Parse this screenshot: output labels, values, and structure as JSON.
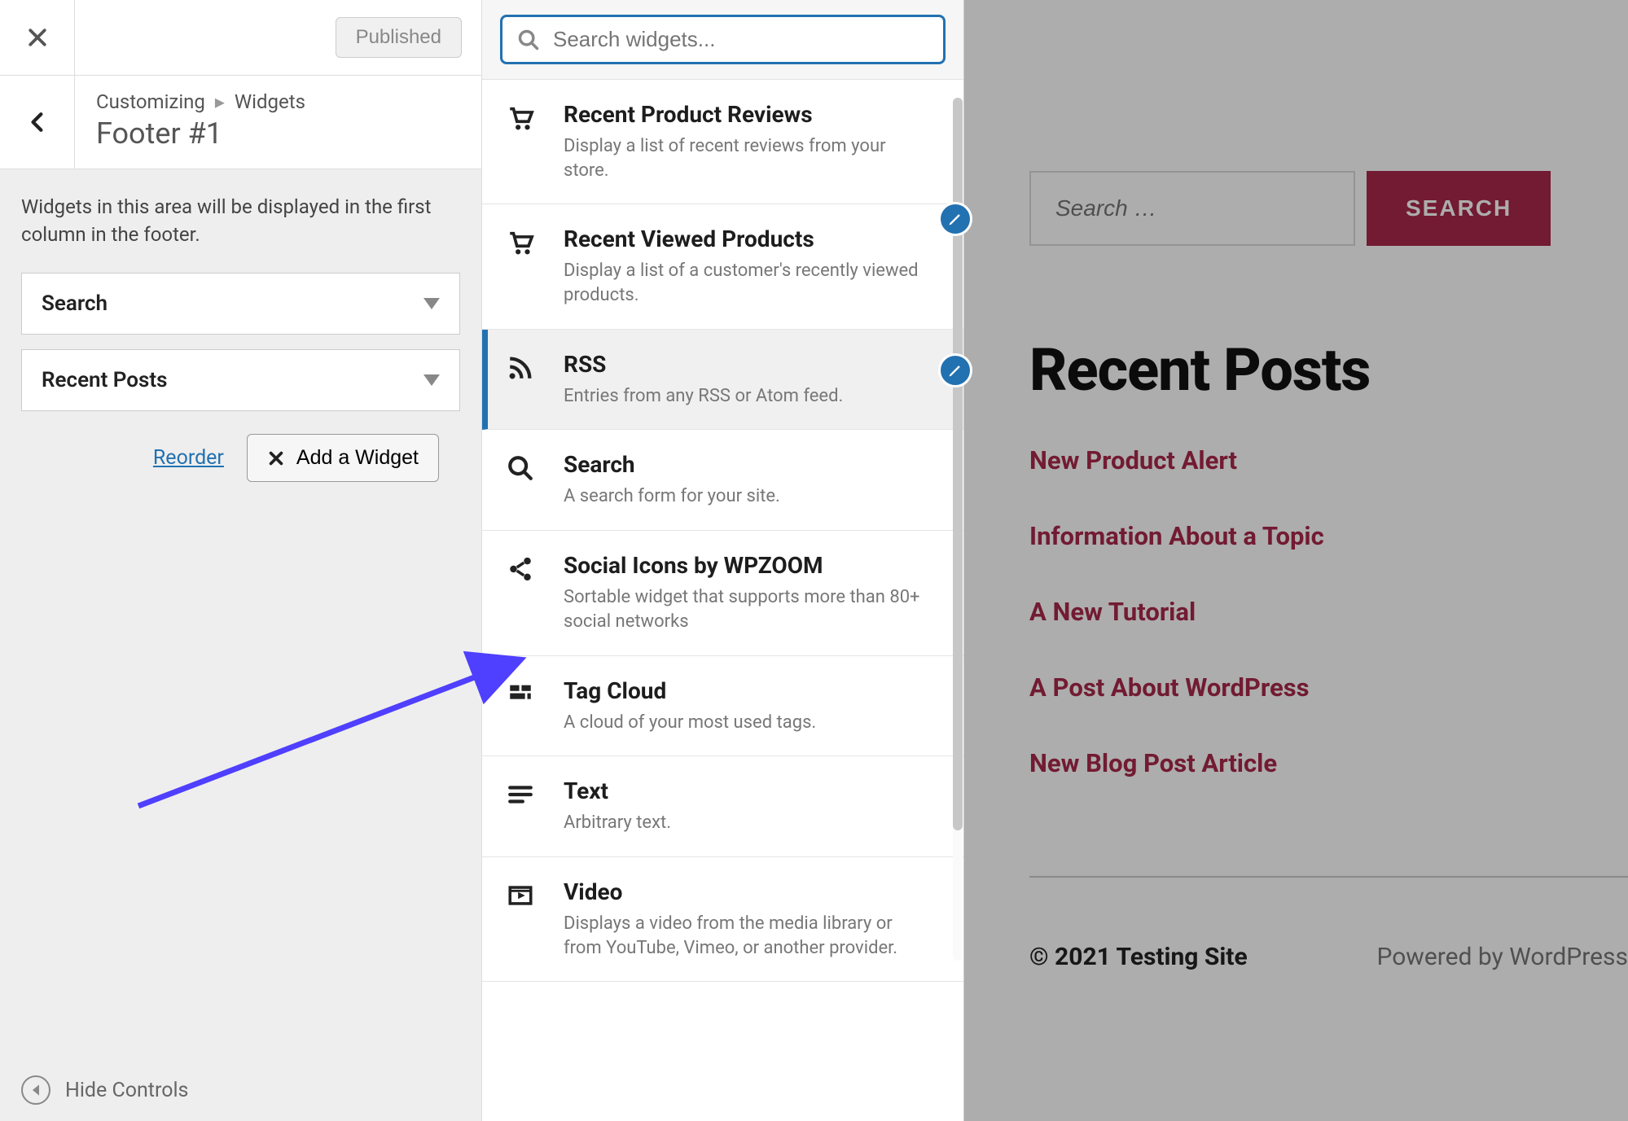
{
  "header": {
    "publish_label": "Published",
    "breadcrumb_root": "Customizing",
    "breadcrumb_section": "Widgets",
    "panel_title": "Footer #1",
    "description": "Widgets in this area will be displayed in the first column in the footer."
  },
  "configured": {
    "items": [
      {
        "label": "Search"
      },
      {
        "label": "Recent Posts"
      }
    ],
    "reorder_label": "Reorder",
    "add_label": "Add a Widget"
  },
  "hide_controls_label": "Hide Controls",
  "picker": {
    "search_placeholder": "Search widgets...",
    "options": [
      {
        "title": "Recent Product Reviews",
        "sub": "Display a list of recent reviews from your store.",
        "icon": "cart-icon"
      },
      {
        "title": "Recent Viewed Products",
        "sub": "Display a list of a customer's recently viewed products.",
        "icon": "cart-icon"
      },
      {
        "title": "RSS",
        "sub": "Entries from any RSS or Atom feed.",
        "icon": "rss-icon",
        "active": true
      },
      {
        "title": "Search",
        "sub": "A search form for your site.",
        "icon": "search-icon"
      },
      {
        "title": "Social Icons by WPZOOM",
        "sub": "Sortable widget that supports more than 80+ social networks",
        "icon": "share-icon"
      },
      {
        "title": "Tag Cloud",
        "sub": "A cloud of your most used tags.",
        "icon": "grid-icon"
      },
      {
        "title": "Text",
        "sub": "Arbitrary text.",
        "icon": "text-icon"
      },
      {
        "title": "Video",
        "sub": "Displays a video from the media library or from YouTube, Vimeo, or another provider.",
        "icon": "video-icon"
      }
    ]
  },
  "preview": {
    "search_placeholder": "Search …",
    "search_button": "SEARCH",
    "recent_heading": "Recent Posts",
    "recent_posts": [
      "New Product Alert",
      "Information About a Topic",
      "A New Tutorial",
      "A Post About WordPress",
      "New Blog Post Article"
    ],
    "copyright": "© 2021 Testing Site",
    "powered": "Powered by WordPress"
  }
}
